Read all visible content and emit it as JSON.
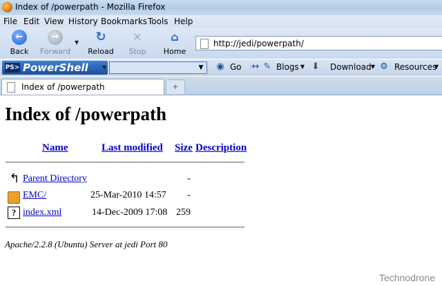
{
  "window": {
    "title": "Index of /powerpath - Mozilla Firefox"
  },
  "menu": [
    "File",
    "Edit",
    "View",
    "History",
    "Bookmarks",
    "Tools",
    "Help"
  ],
  "nav": {
    "back": "Back",
    "forward": "Forward",
    "reload": "Reload",
    "stop": "Stop",
    "home": "Home",
    "url": "http://jedi/powerpath/"
  },
  "toolbar": {
    "brand": "PowerShell",
    "brand_prompt": "PS>",
    "search_value": "",
    "go": "Go",
    "blogs": "Blogs",
    "download": "Download",
    "resources": "Resources"
  },
  "tabs": [
    {
      "label": "Index of /powerpath"
    }
  ],
  "page": {
    "heading": "Index of /powerpath",
    "columns": [
      "Name",
      "Last modified",
      "Size",
      "Description"
    ],
    "rows": [
      {
        "icon": "back-icon",
        "name": "Parent Directory",
        "modified": "",
        "size": "-",
        "description": ""
      },
      {
        "icon": "folder-icon",
        "name": "EMC/",
        "modified": "25-Mar-2010 14:57",
        "size": "-",
        "description": ""
      },
      {
        "icon": "unknown-file-icon",
        "name": "index.xml",
        "modified": "14-Dec-2009 17:08",
        "size": "259",
        "description": ""
      }
    ],
    "address": "Apache/2.2.8 (Ubuntu) Server at jedi Port 80"
  },
  "watermark": "Technodrone",
  "colors": {
    "link": "#0000cc",
    "titlebar": "#b3cbe6",
    "toolbar": "#c9d9ee",
    "powershell_brand": "#1d4f9d"
  }
}
